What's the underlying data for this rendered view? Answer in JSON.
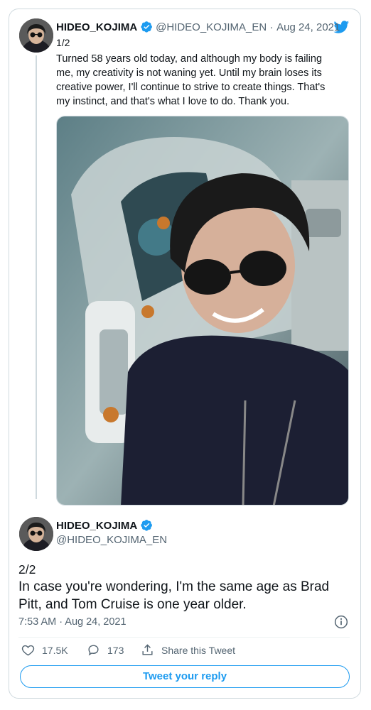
{
  "tweet1": {
    "name": "HIDEO_KOJIMA",
    "handle": "@HIDEO_KOJIMA_EN",
    "separator": "·",
    "date": "Aug 24, 2021",
    "thread_index": "1/2",
    "text": "Turned 58 years old today, and although my body is failing me, my creativity is not waning yet. Until my brain loses its creative power, I'll continue to strive to create things. That's my instinct, and that's what I love to do. Thank you."
  },
  "tweet2": {
    "name": "HIDEO_KOJIMA",
    "handle": "@HIDEO_KOJIMA_EN",
    "thread_index": "2/2",
    "text": "In case you're wondering, I'm the same age as Brad Pitt, and Tom Cruise is one year older.",
    "timestamp": "7:53 AM · Aug 24, 2021"
  },
  "actions": {
    "likes": "17.5K",
    "replies": "173",
    "share_label": "Share this Tweet"
  },
  "reply_button": "Tweet your reply",
  "colors": {
    "accent": "#1d9bf0",
    "text": "#0f1419",
    "muted": "#536471",
    "border": "#cfd9de"
  },
  "icons": [
    "twitter-bird-icon",
    "verified-badge-icon",
    "heart-icon",
    "reply-bubble-icon",
    "share-icon",
    "info-icon"
  ]
}
